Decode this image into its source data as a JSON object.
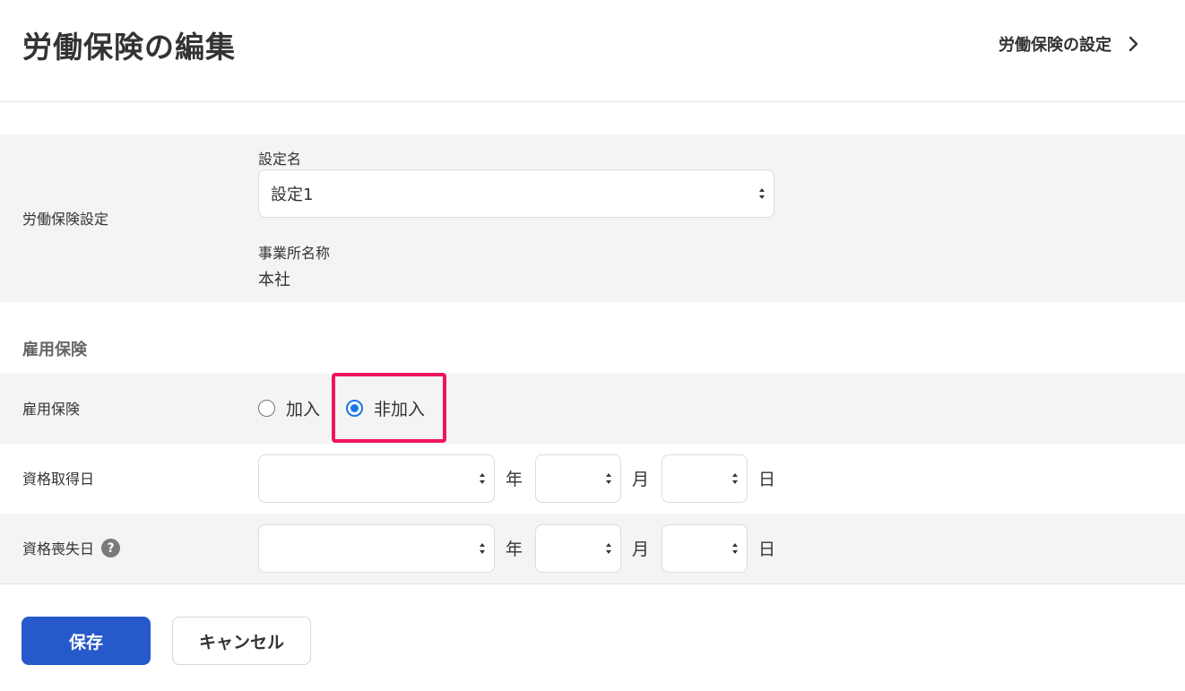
{
  "header": {
    "title": "労働保険の編集",
    "settings_link": "労働保険の設定"
  },
  "labor_insurance": {
    "row_label": "労働保険設定",
    "setting_name_label": "設定名",
    "setting_name_value": "設定1",
    "office_name_label": "事業所名称",
    "office_name_value": "本社"
  },
  "employment_insurance": {
    "section_heading": "雇用保険",
    "row_label": "雇用保険",
    "options": [
      {
        "label": "加入",
        "checked": false
      },
      {
        "label": "非加入",
        "checked": true
      }
    ]
  },
  "acquisition_date": {
    "row_label": "資格取得日",
    "year_value": "",
    "month_value": "",
    "day_value": "",
    "year_unit": "年",
    "month_unit": "月",
    "day_unit": "日"
  },
  "loss_date": {
    "row_label": "資格喪失日",
    "help_glyph": "?",
    "year_value": "",
    "month_value": "",
    "day_value": "",
    "year_unit": "年",
    "month_unit": "月",
    "day_unit": "日"
  },
  "actions": {
    "save_label": "保存",
    "cancel_label": "キャンセル"
  },
  "colors": {
    "primary": "#2659c9",
    "radio_checked": "#1a73e8",
    "highlight": "#f0145a",
    "band": "#f5f4f5"
  }
}
